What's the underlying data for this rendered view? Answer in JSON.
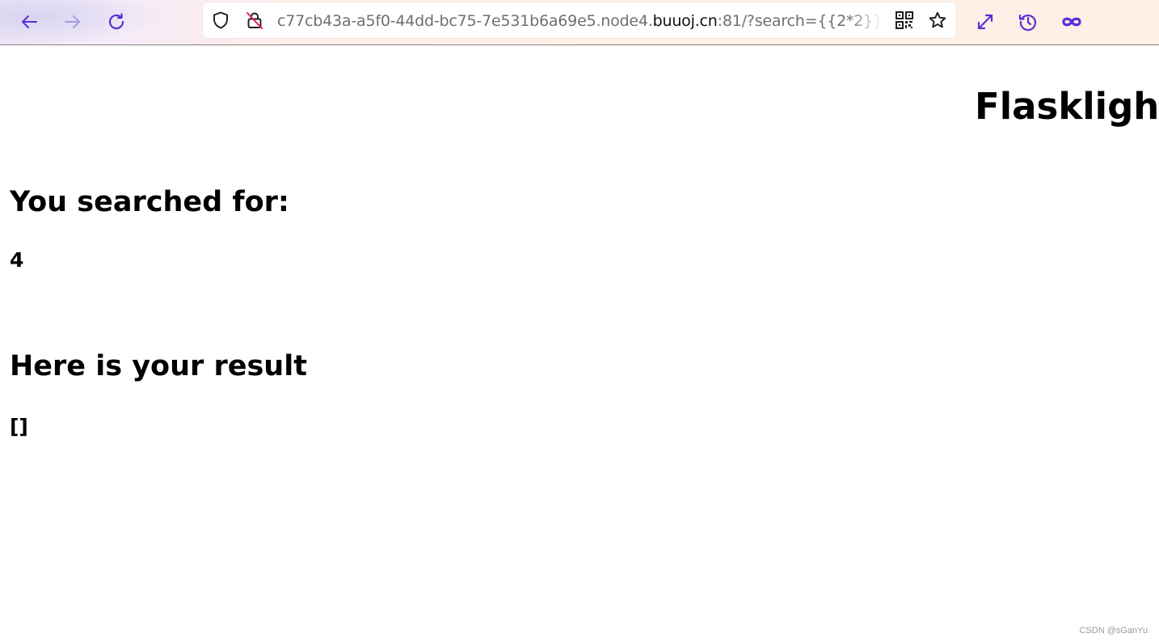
{
  "browser": {
    "url_prefix": "c77cb43a-a5f0-44dd-bc75-7e531b6a69e5.node4.",
    "url_host": "buuoj.cn",
    "url_suffix": ":81/?search={{2*2}}",
    "accent_color": "#5b2fd6",
    "icons": [
      "back-arrow-icon",
      "forward-arrow-icon",
      "reload-icon",
      "shield-icon",
      "insecure-lock-icon",
      "qr-code-icon",
      "star-icon",
      "expand-icon",
      "history-icon",
      "infinity-icon"
    ]
  },
  "page": {
    "title": "Flasklight",
    "searched_heading": "You searched for:",
    "searched_value": "4",
    "result_heading": "Here is your result",
    "result_value": "[]"
  },
  "watermark": "CSDN @sGanYu"
}
